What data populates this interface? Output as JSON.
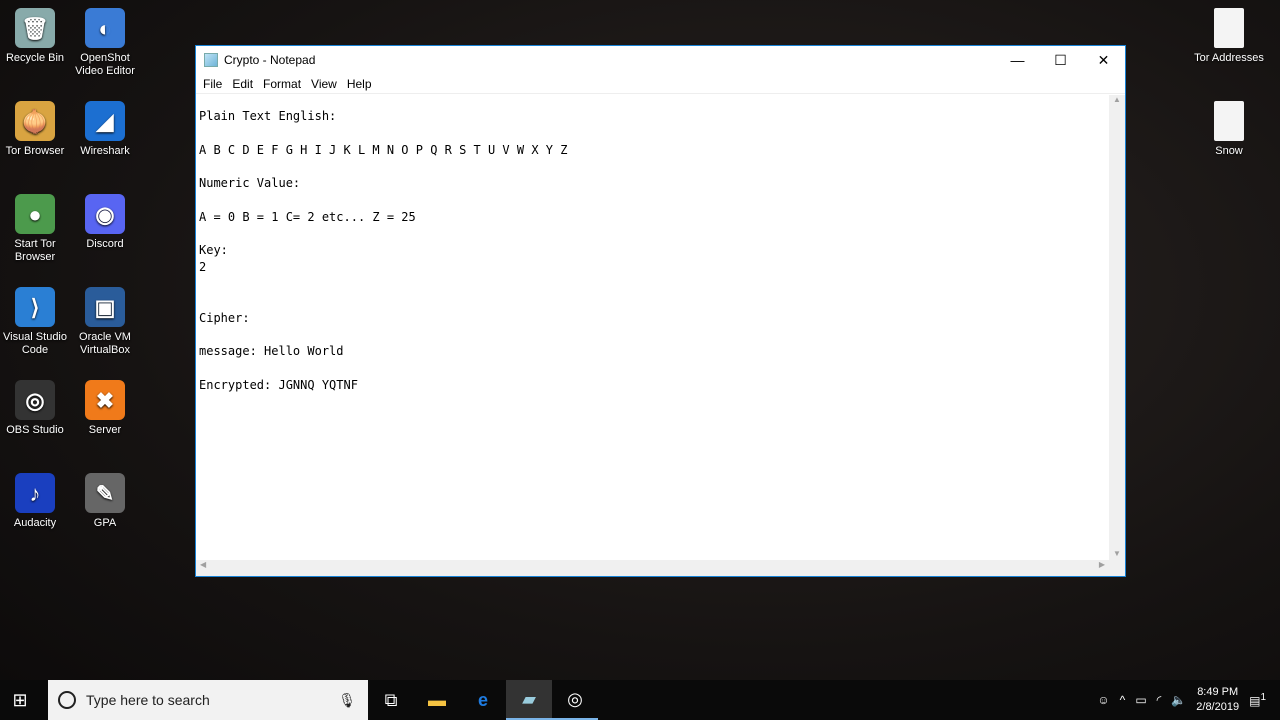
{
  "desktop_left": [
    {
      "label": "Recycle Bin",
      "glyph": "🗑",
      "color": "#8aa"
    },
    {
      "label": "OpenShot Video Editor",
      "glyph": "◐",
      "color": "#3a7bd5"
    },
    {
      "label": "Tor Browser",
      "glyph": "🧅",
      "color": "#d9a441"
    },
    {
      "label": "Wireshark",
      "glyph": "◢",
      "color": "#1c6fd1"
    },
    {
      "label": "Start Tor Browser",
      "glyph": "●",
      "color": "#4c9a4c"
    },
    {
      "label": "Discord",
      "glyph": "◉",
      "color": "#5865f2"
    },
    {
      "label": "Visual Studio Code",
      "glyph": "⟩",
      "color": "#2a7fd4"
    },
    {
      "label": "Oracle VM VirtualBox",
      "glyph": "▣",
      "color": "#2a5c9a"
    },
    {
      "label": "OBS Studio",
      "glyph": "◎",
      "color": "#333"
    },
    {
      "label": "Server",
      "glyph": "✖",
      "color": "#f07a1a"
    },
    {
      "label": "Audacity",
      "glyph": "♪",
      "color": "#1a3fbf"
    },
    {
      "label": "GPA",
      "glyph": "✎",
      "color": "#666"
    }
  ],
  "desktop_right": [
    {
      "label": "Tor Addresses"
    },
    {
      "label": "Snow"
    }
  ],
  "window": {
    "title": "Crypto - Notepad",
    "menu": [
      "File",
      "Edit",
      "Format",
      "View",
      "Help"
    ],
    "content": "Plain Text English:\n\nA B C D E F G H I J K L M N O P Q R S T U V W X Y Z\n\nNumeric Value:\n\nA = 0 B = 1 C= 2 etc... Z = 25\n\nKey:\n2\n\n\nCipher:\n\nmessage: Hello World\n\nEncrypted: JGNNQ YQTNF"
  },
  "taskbar": {
    "search_placeholder": "Type here to search",
    "time": "8:49 PM",
    "date": "2/8/2019",
    "notification_count": "1"
  }
}
